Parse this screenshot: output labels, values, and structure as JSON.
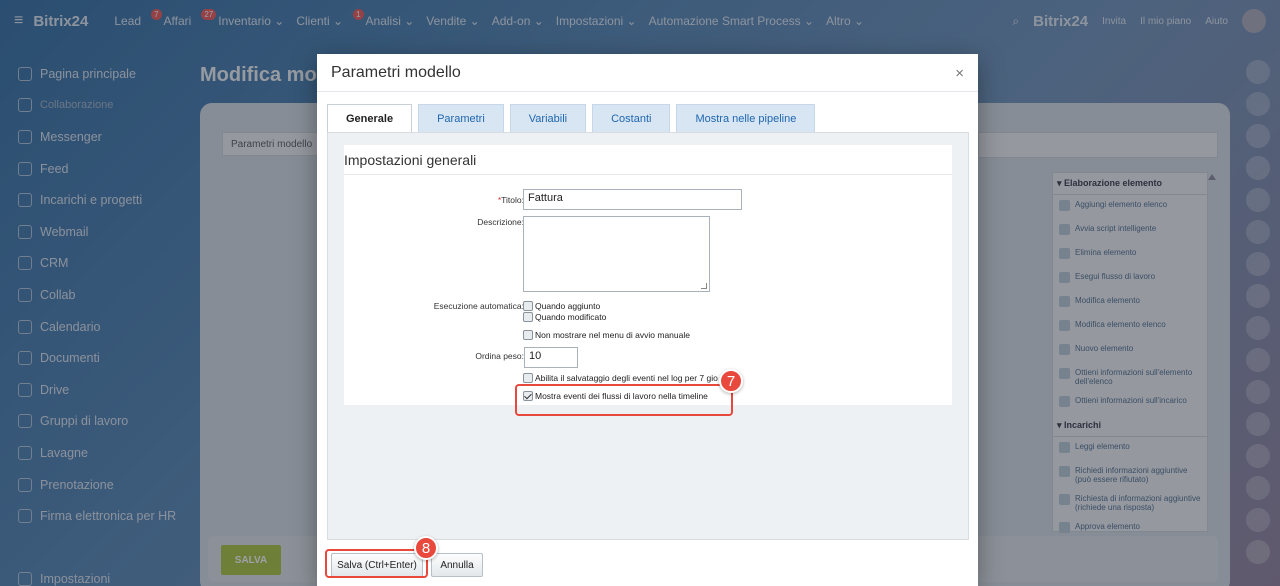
{
  "topbar": {
    "brand": "Bitrix24",
    "nav": [
      {
        "label": "Lead",
        "badge": "7"
      },
      {
        "label": "Affari",
        "badge": "27"
      },
      {
        "label": "Inventario ⌄",
        "badge": ""
      },
      {
        "label": "Clienti ⌄",
        "badge": "1"
      },
      {
        "label": "Analisi ⌄",
        "badge": ""
      },
      {
        "label": "Vendite ⌄",
        "badge": ""
      },
      {
        "label": "Add-on ⌄",
        "badge": ""
      },
      {
        "label": "Impostazioni ⌄",
        "badge": ""
      },
      {
        "label": "Automazione Smart Process ⌄",
        "badge": ""
      },
      {
        "label": "Altro ⌄",
        "badge": ""
      }
    ],
    "brand_right": "Bitrix24",
    "invite": "Invita",
    "plan": "Il mio piano",
    "help": "Aiuto",
    "help_badge": "10"
  },
  "sidebar": {
    "items": [
      {
        "label": "Pagina principale",
        "dim": false
      },
      {
        "label": "Collaborazione",
        "dim": true
      },
      {
        "label": "Messenger",
        "dim": false
      },
      {
        "label": "Feed",
        "dim": false
      },
      {
        "label": "Incarichi e progetti",
        "dim": false
      },
      {
        "label": "Webmail",
        "dim": false
      },
      {
        "label": "CRM",
        "dim": false
      },
      {
        "label": "Collab",
        "dim": false
      },
      {
        "label": "Calendario",
        "dim": false
      },
      {
        "label": "Documenti",
        "dim": false
      },
      {
        "label": "Drive",
        "dim": false
      },
      {
        "label": "Gruppi di lavoro",
        "dim": false
      },
      {
        "label": "Lavagne",
        "dim": false
      },
      {
        "label": "Prenotazione",
        "dim": false
      },
      {
        "label": "Firma elettronica per HR",
        "dim": false
      },
      {
        "label": "",
        "dim": false
      },
      {
        "label": "Impostazioni",
        "dim": false
      }
    ]
  },
  "page": {
    "title": "Modifica mod",
    "panel_tab": "Parametri modello",
    "save_bg": "SALVA"
  },
  "palette": {
    "group1": "▾ Elaborazione elemento",
    "items1": [
      "Aggiungi elemento elenco",
      "Avvia script intelligente",
      "Elimina elemento",
      "Esegui flusso di lavoro",
      "Modifica elemento",
      "Modifica elemento elenco",
      "Nuovo elemento",
      "Ottieni informazioni sull'elemento dell'elenco",
      "Ottieni informazioni sull'incarico"
    ],
    "group2": "▾ Incarichi",
    "items2": [
      "Leggi elemento",
      "Richiedi informazioni aggiuntive (può essere rifiutato)",
      "Richiesta di informazioni aggiuntive (richiede una risposta)",
      "Approva elemento"
    ]
  },
  "dialog": {
    "title": "Parametri modello",
    "close": "×",
    "tabs": [
      "Generale",
      "Parametri",
      "Variabili",
      "Costanti",
      "Mostra nelle pipeline"
    ],
    "section_title": "Impostazioni generali",
    "title_label": "Titolo:",
    "title_required": "*",
    "title_value": "Fattura",
    "desc_label": "Descrizione:",
    "auto_label": "Esecuzione automatica:",
    "on_add": "Quando aggiunto",
    "on_edit": "Quando modificato",
    "hide_manual": "Non mostrare nel menu di avvio manuale",
    "weight_label": "Ordina peso:",
    "weight_value": "10",
    "log_label": "Abilita il salvataggio degli eventi nel log per 7 gio",
    "timeline_label": "Mostra eventi dei flussi di lavoro nella timeline",
    "save_btn": "Salva (Ctrl+Enter)",
    "cancel_btn": "Annulla",
    "step7": "7",
    "step8": "8"
  },
  "colors": {
    "accent": "#e8493c",
    "tab_link": "#2067b0",
    "save_green": "#a8c43a"
  }
}
